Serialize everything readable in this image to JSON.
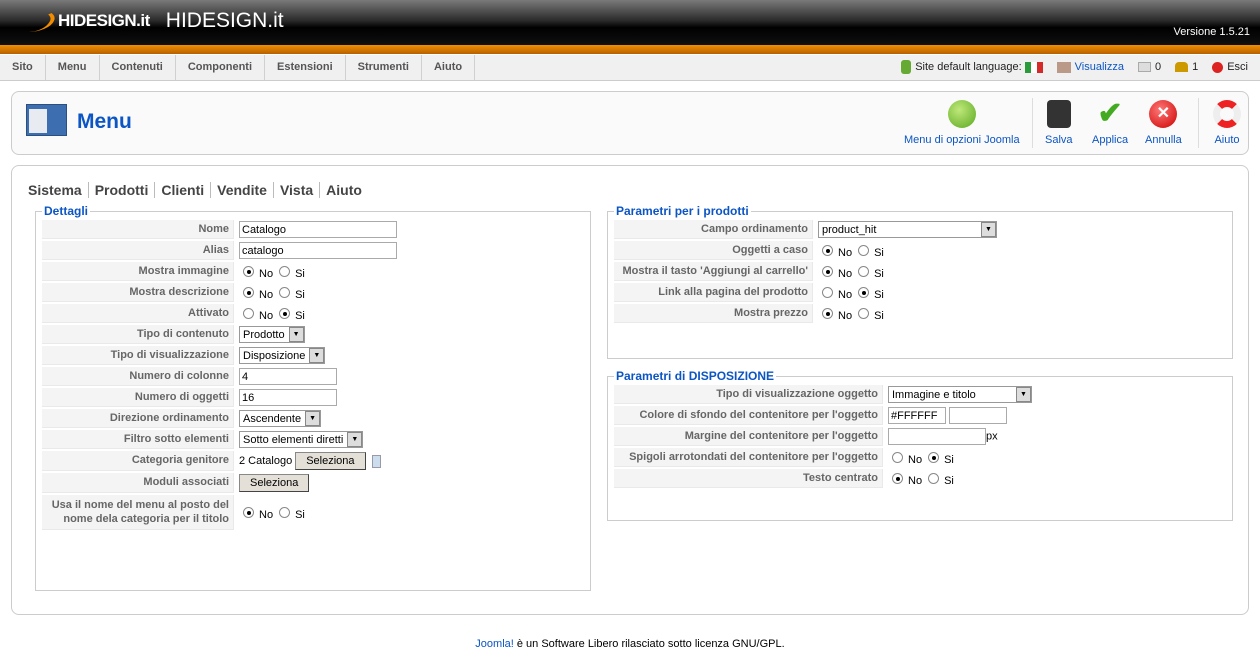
{
  "header": {
    "logo_text": "HIDESIGN.it",
    "site_name": "HIDESIGN.it",
    "version": "Versione 1.5.21"
  },
  "menubar": [
    "Sito",
    "Menu",
    "Contenuti",
    "Componenti",
    "Estensioni",
    "Strumenti",
    "Aiuto"
  ],
  "status": {
    "language_label": "Site default language:",
    "preview": "Visualizza",
    "messages": "0",
    "users": "1",
    "logout": "Esci"
  },
  "toolbar": {
    "title": "Menu",
    "options": "Menu di opzioni Joomla",
    "save": "Salva",
    "apply": "Applica",
    "cancel": "Annulla",
    "help": "Aiuto"
  },
  "subnav": [
    "Sistema",
    "Prodotti",
    "Clienti",
    "Vendite",
    "Vista",
    "Aiuto"
  ],
  "fieldsets": [
    {
      "legend": "Dettagli",
      "rows": [
        {
          "label": "Nome",
          "type": "text",
          "value": "Catalogo",
          "w": 158
        },
        {
          "label": "Alias",
          "type": "text",
          "value": "catalogo",
          "w": 158
        },
        {
          "label": "Mostra immagine",
          "type": "radio",
          "value": "No"
        },
        {
          "label": "Mostra descrizione",
          "type": "radio",
          "value": "No"
        },
        {
          "label": "Attivato",
          "type": "radio",
          "value": "Si"
        },
        {
          "label": "Tipo di contenuto",
          "type": "select",
          "value": "Prodotto"
        },
        {
          "label": "Tipo di visualizzazione",
          "type": "select",
          "value": "Disposizione"
        },
        {
          "label": "Numero di colonne",
          "type": "text",
          "value": "4",
          "w": 98
        },
        {
          "label": "Numero di oggetti",
          "type": "text",
          "value": "16",
          "w": 98
        },
        {
          "label": "Direzione ordinamento",
          "type": "select",
          "value": "Ascendente"
        },
        {
          "label": "Filtro sotto elementi",
          "type": "select",
          "value": "Sotto elementi diretti"
        },
        {
          "label": "Categoria genitore",
          "type": "category",
          "value": "2 Catalogo",
          "button": "Seleziona"
        },
        {
          "label": "Moduli associati",
          "type": "button",
          "button": "Seleziona"
        },
        {
          "label": "Usa il nome del menu al posto del nome dela categoria per il titolo",
          "type": "radio",
          "value": "No"
        }
      ]
    },
    {
      "legend": "Parametri per i prodotti",
      "rows": [
        {
          "label": "Campo ordinamento",
          "type": "select",
          "value": "product_hit",
          "sw": 155
        },
        {
          "label": "Oggetti a caso",
          "type": "radio",
          "value": "No"
        },
        {
          "label": "Mostra il tasto 'Aggiungi al carrello'",
          "type": "radio",
          "value": "No"
        },
        {
          "label": "Link alla pagina del prodotto",
          "type": "radio",
          "value": "Si"
        },
        {
          "label": "Mostra prezzo",
          "type": "radio",
          "value": "No"
        }
      ]
    },
    {
      "legend": "Parametri di DISPOSIZIONE",
      "rows": [
        {
          "label": "Tipo di visualizzazione oggetto",
          "type": "select",
          "value": "Immagine e titolo",
          "sw": 120
        },
        {
          "label": "Colore di sfondo del contenitore per l'oggetto",
          "type": "color",
          "value": "#FFFFFF"
        },
        {
          "label": "Margine del contenitore per l'oggetto",
          "type": "px",
          "value": "",
          "suffix": "px"
        },
        {
          "label": "Spigoli arrotondati del contenitore per l'oggetto",
          "type": "radio",
          "value": "Si"
        },
        {
          "label": "Testo centrato",
          "type": "radio",
          "value": "No"
        }
      ]
    }
  ],
  "radio_options": [
    "No",
    "Si"
  ],
  "footer": {
    "link": "Joomla!",
    "text": " è un Software Libero rilasciato sotto licenza GNU/GPL."
  }
}
